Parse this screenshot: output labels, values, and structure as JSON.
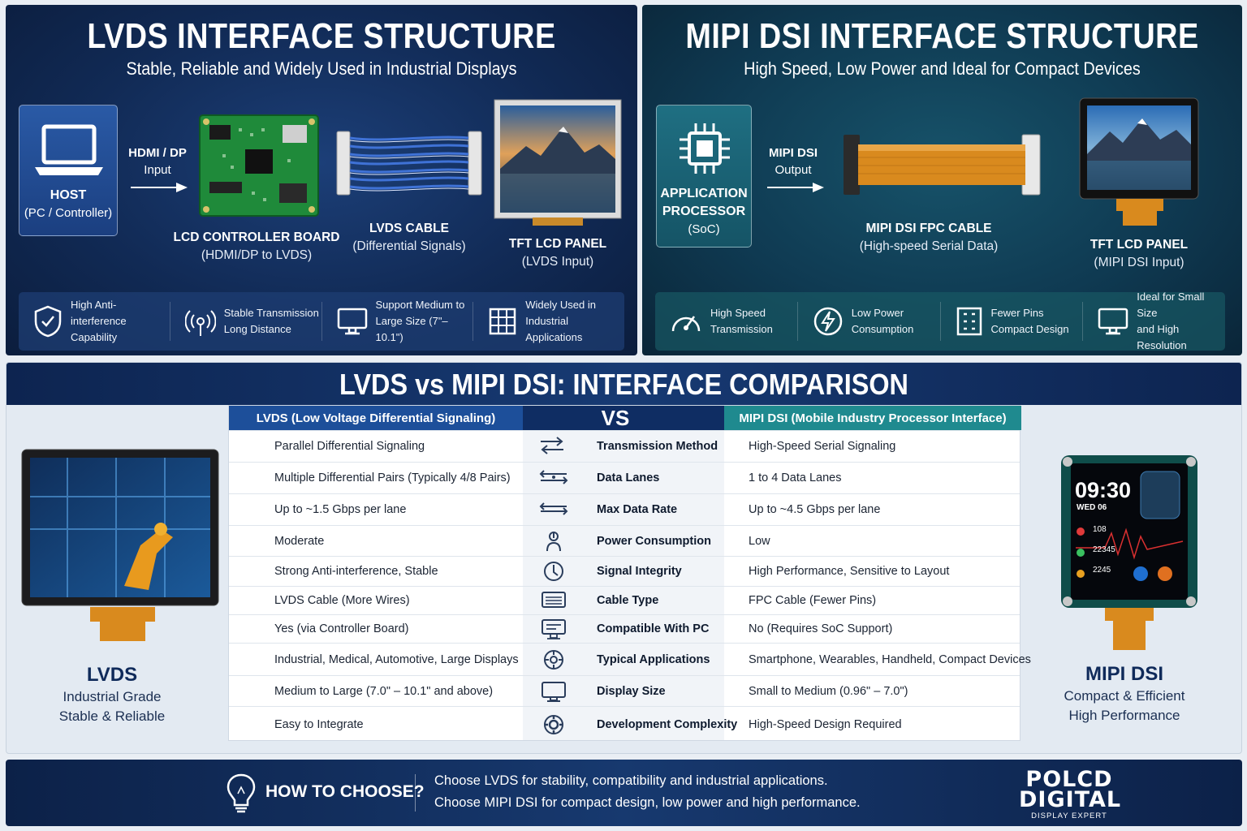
{
  "lvds": {
    "title": "LVDS INTERFACE STRUCTURE",
    "subtitle": "Stable, Reliable and Widely Used in Industrial Displays",
    "host": {
      "title": "HOST",
      "sub": "(PC / Controller)"
    },
    "arrow": {
      "line1": "HDMI / DP",
      "line2": "Input"
    },
    "board": {
      "title": "LCD CONTROLLER BOARD",
      "sub": "(HDMI/DP to LVDS)"
    },
    "cable": {
      "title": "LVDS CABLE",
      "sub": "(Differential Signals)"
    },
    "panel": {
      "title": "TFT LCD PANEL",
      "sub": "(LVDS Input)"
    },
    "features": [
      {
        "icon": "shield-check-icon",
        "text": "High Anti-interference\nCapability"
      },
      {
        "icon": "signal-waves-icon",
        "text": "Stable Transmission\nLong Distance"
      },
      {
        "icon": "monitor-icon",
        "text": "Support Medium to\nLarge Size (7\"–10.1\")"
      },
      {
        "icon": "grid-icon",
        "text": "Widely Used in\nIndustrial Applications"
      }
    ]
  },
  "mipi": {
    "title": "MIPI DSI INTERFACE STRUCTURE",
    "subtitle": "High Speed, Low Power and Ideal for Compact Devices",
    "processor": {
      "line1": "APPLICATION",
      "line2": "PROCESSOR",
      "line3": "(SoC)"
    },
    "arrow": {
      "line1": "MIPI DSI",
      "line2": "Output"
    },
    "cable": {
      "title": "MIPI DSI FPC CABLE",
      "sub": "(High-speed Serial Data)"
    },
    "panel": {
      "title": "TFT LCD PANEL",
      "sub": "(MIPI DSI Input)"
    },
    "features": [
      {
        "icon": "speedometer-icon",
        "text": "High Speed\nTransmission"
      },
      {
        "icon": "lightning-icon",
        "text": "Low Power\nConsumption"
      },
      {
        "icon": "pins-icon",
        "text": "Fewer Pins\nCompact Design"
      },
      {
        "icon": "monitor-icon",
        "text": "Ideal for Small Size\nand High Resolution"
      }
    ]
  },
  "comparison": {
    "title": "LVDS vs MIPI DSI: INTERFACE COMPARISON",
    "header_left": "LVDS (Low Voltage Differential Signaling)",
    "header_mid": "VS",
    "header_right": "MIPI DSI (Mobile Industry Processor Interface)",
    "rows": [
      {
        "lvds": "Parallel Differential Signaling",
        "aspect": "Transmission Method",
        "mipi": "High-Speed Serial Signaling",
        "icon": "arrows-icon"
      },
      {
        "lvds": "Multiple Differential Pairs (Typically 4/8 Pairs)",
        "aspect": "Data Lanes",
        "mipi": "1 to 4 Data Lanes",
        "icon": "lanes-icon"
      },
      {
        "lvds": "Up to ~1.5 Gbps per lane",
        "aspect": "Max Data Rate",
        "mipi": "Up to ~4.5 Gbps per lane",
        "icon": "rate-icon"
      },
      {
        "lvds": "Moderate",
        "aspect": "Power Consumption",
        "mipi": "Low",
        "icon": "power-hand-icon"
      },
      {
        "lvds": "Strong Anti-interference, Stable",
        "aspect": "Signal Integrity",
        "mipi": "High Performance, Sensitive to Layout",
        "icon": "signal-integrity-icon"
      },
      {
        "lvds": "LVDS Cable (More Wires)",
        "aspect": "Cable Type",
        "mipi": "FPC Cable (Fewer Pins)",
        "icon": "cable-icon"
      },
      {
        "lvds": "Yes (via Controller Board)",
        "aspect": "Compatible With PC",
        "mipi": "No (Requires SoC Support)",
        "icon": "pc-icon"
      },
      {
        "lvds": "Industrial, Medical, Automotive, Large Displays",
        "aspect": "Typical Applications",
        "mipi": "Smartphone, Wearables, Handheld, Compact Devices",
        "icon": "applications-icon"
      },
      {
        "lvds": "Medium to Large (7.0\" – 10.1\" and above)",
        "aspect": "Display Size",
        "mipi": "Small to Medium (0.96\" – 7.0\")",
        "icon": "display-icon"
      },
      {
        "lvds": "Easy to Integrate",
        "aspect": "Development Complexity",
        "mipi": "High-Speed Design Required",
        "icon": "gear-icon"
      }
    ],
    "left_caption": {
      "title": "LVDS",
      "line1": "Industrial Grade",
      "line2": "Stable & Reliable"
    },
    "right_caption": {
      "title": "MIPI DSI",
      "line1": "Compact & Efficient",
      "line2": "High Performance"
    },
    "watch": {
      "time": "09:30",
      "date": "WED 06",
      "heart": "108",
      "steps": "22345",
      "calories": "2245"
    }
  },
  "footer": {
    "question": "HOW TO CHOOSE?",
    "line1": "Choose LVDS for stability, compatibility and industrial applications.",
    "line2": "Choose MIPI DSI for compact design, low power and high performance.",
    "brand1": "POLCD",
    "brand2": "DIGITAL",
    "tagline": "DISPLAY EXPERT"
  },
  "colors": {
    "lvds_header": "#1d4f9a",
    "vs_header": "#0f2d63",
    "mipi_header": "#1f8a8f",
    "accent_orange": "#d98a1e"
  }
}
